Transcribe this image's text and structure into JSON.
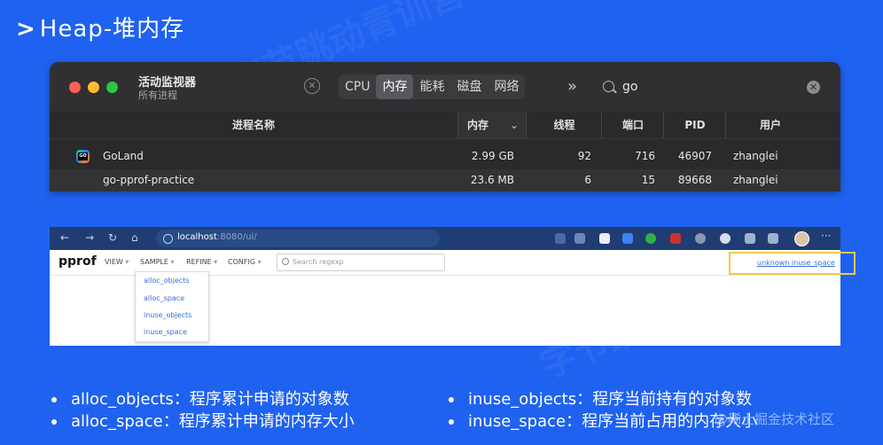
{
  "slide": {
    "title_arrow": ">",
    "title": "Heap-堆内存"
  },
  "activity_monitor": {
    "title": "活动监视器",
    "subtitle": "所有进程",
    "stop_icon": "stop-process-icon",
    "tabs": [
      {
        "label": "CPU",
        "active": false
      },
      {
        "label": "内存",
        "active": true
      },
      {
        "label": "能耗",
        "active": false
      },
      {
        "label": "磁盘",
        "active": false
      },
      {
        "label": "网络",
        "active": false
      }
    ],
    "overflow": "»",
    "search_value": "go",
    "clear_icon": "✕",
    "columns": {
      "name": "进程名称",
      "memory": "内存",
      "sort_indicator": "⌄",
      "threads": "线程",
      "ports": "端口",
      "pid": "PID",
      "user": "用户"
    },
    "rows": [
      {
        "name": "GoLand",
        "memory": "2.99 GB",
        "threads": "92",
        "ports": "716",
        "pid": "46907",
        "user": "zhanglei"
      },
      {
        "name": "go-pprof-practice",
        "memory": "23.6 MB",
        "threads": "6",
        "ports": "15",
        "pid": "89668",
        "user": "zhanglei"
      }
    ]
  },
  "browser": {
    "nav_back": "←",
    "nav_forward": "→",
    "nav_reload": "↻",
    "nav_home": "⌂",
    "url_host": "localhost",
    "url_path": ":8080/ui/",
    "more": "···",
    "pprof": {
      "logo": "pprof",
      "menus": [
        "VIEW",
        "SAMPLE",
        "REFINE",
        "CONFIG"
      ],
      "search_placeholder": "Search regexp",
      "right_link": "unknown inuse_space",
      "sample_options": [
        "alloc_objects",
        "alloc_space",
        "inuse_objects",
        "inuse_space"
      ]
    }
  },
  "bullets": {
    "left_1": "alloc_objects：程序累计申请的对象数",
    "left_2": "alloc_space：程序累计申请的内存大小",
    "right_1": "inuse_objects：程序当前持有的对象数",
    "right_2": "inuse_space：程序当前占用的内存大小"
  },
  "watermark": "@稀土掘金技术社区",
  "background_watermark": "字节跳动青训营",
  "colors": {
    "background": "#1f62f0",
    "highlight": "#f2c94c",
    "link": "#3a6bd8"
  }
}
